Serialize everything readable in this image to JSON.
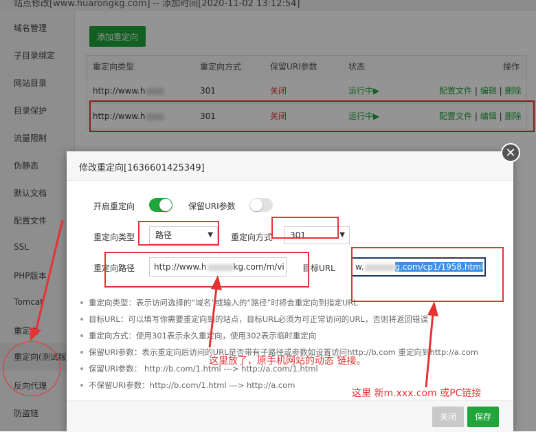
{
  "topbar": {
    "title": "站点修改[www.huarongkg.com] -- 添加时间[2020-11-02 13:12:54]"
  },
  "sidebar": {
    "items": [
      {
        "label": "域名管理"
      },
      {
        "label": "子目录绑定"
      },
      {
        "label": "网站目录"
      },
      {
        "label": "目录保护"
      },
      {
        "label": "流量限制"
      },
      {
        "label": "伪静态"
      },
      {
        "label": "默认文档"
      },
      {
        "label": "配置文件"
      },
      {
        "label": "SSL"
      },
      {
        "label": "PHP版本"
      },
      {
        "label": "Tomcat"
      },
      {
        "label": "重定向"
      },
      {
        "label": "重定向(测试版)"
      },
      {
        "label": "反向代理"
      },
      {
        "label": "防盗链"
      }
    ]
  },
  "toolbar": {
    "add_label": "添加重定向"
  },
  "redirect_table": {
    "headers": [
      "重定向类型",
      "重定向方式",
      "保留URI参数",
      "状态",
      "操作"
    ],
    "rows": [
      {
        "type": "http://www.h",
        "method": "301",
        "keep_uri": "关闭",
        "status": "运行中▶",
        "action_config": "配置文件",
        "action_edit": "编辑",
        "action_delete": "删除",
        "sep": "|"
      },
      {
        "type": "http://www.h",
        "method": "301",
        "keep_uri": "关闭",
        "status": "运行中▶",
        "action_config": "配置文件",
        "action_edit": "编辑",
        "action_delete": "删除",
        "sep": "|"
      }
    ]
  },
  "dialog": {
    "title": "修改重定向[1636601425349]",
    "close_glyph": "✕",
    "enable_label": "开启重定向",
    "enable_on": true,
    "keep_uri_label": "保留URI参数",
    "keep_uri_on": false,
    "type_label": "重定向类型",
    "type_value": "路径",
    "method_label": "重定向方式",
    "method_value": "301",
    "path_label": "重定向路径",
    "path_value_pre": "http://www.h",
    "path_value_post": "kg.com/m/vi",
    "target_label": "目标URL",
    "target_value_pre": "w.",
    "target_value_post": "g.com/cp1/1958.html",
    "tips": [
      "重定向类型：表示访问选择的“域名”或输入的“路径”时将会重定向到指定URL",
      "目标URL：可以填写你需要重定向到的站点，目标URL必须为可正常访问的URL，否则将返回错误",
      "重定向方式：使用301表示永久重定向，使用302表示临时重定向",
      "保留URI参数：表示重定向后访问的URL是否带有子路径或参数如设置访问http://b.com 重定向到http://a.com",
      "保留URI参数：  http://b.com/1.html ---> http://a.com/1.html",
      "不保留URI参数：http://b.com/1.html ---> http://a.com"
    ],
    "cancel_label": "关闭",
    "save_label": "保存"
  },
  "annotations": {
    "note_left": "这里放了，原手机网站的动态 链接。",
    "note_right": "这里 新m.xxx.com  或PC链接"
  },
  "colors": {
    "accent_green": "#20a53a",
    "annotation_red": "#e53333",
    "status_red": "#d9302c"
  },
  "icons": {
    "close": "close-icon",
    "select": "chevron-down-icon",
    "status": "play-icon"
  }
}
